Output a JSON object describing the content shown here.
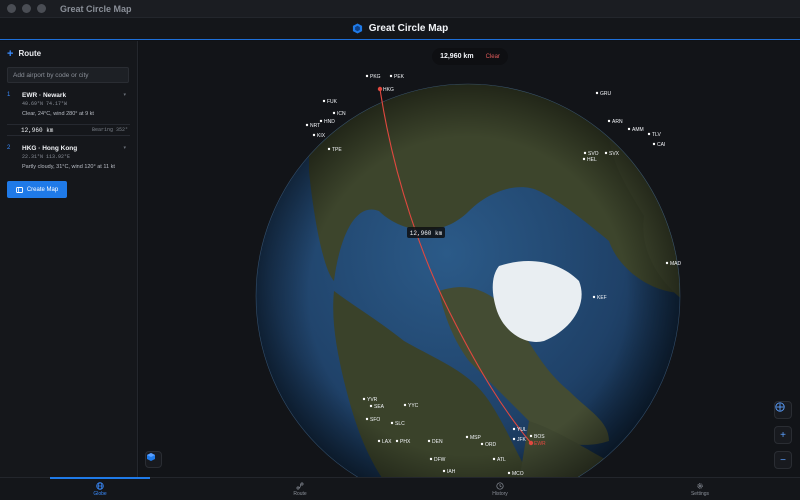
{
  "window": {
    "title": "Great Circle Map"
  },
  "header": {
    "app_name": "Great Circle Map"
  },
  "sidebar": {
    "section_title": "Route",
    "search_placeholder": "Add airport by code or city",
    "stops": [
      {
        "index": "1",
        "name": "EWR · Newark",
        "coords": "40.69°N 74.17°W",
        "weather": "Clear, 24°C, wind 280° at 9 kt"
      },
      {
        "index": "2",
        "name": "HKG · Hong Kong",
        "coords": "22.31°N 113.92°E",
        "weather": "Partly cloudy, 31°C, wind 120° at 11 kt"
      }
    ],
    "leg": {
      "distance": "12,960 km",
      "bearing": "Bearing 352°"
    },
    "create_button": "Create Map"
  },
  "map": {
    "distance_pill": "12,960 km",
    "clear_label": "Clear",
    "route_label": "12,960 km",
    "airports": [
      "PKG",
      "PEK",
      "ICN",
      "NRT",
      "KIX",
      "HND",
      "TPE",
      "HKG",
      "FUK",
      "GRU",
      "ARN",
      "HEL",
      "SVO",
      "SVX",
      "AMM",
      "TLV",
      "CAI",
      "KEF",
      "MAD",
      "YVR",
      "SEA",
      "YYC",
      "SFO",
      "SLC",
      "LAX",
      "PHX",
      "DEN",
      "MSP",
      "ORD",
      "YUL",
      "BOS",
      "JFK",
      "EWR",
      "ATL",
      "DFW",
      "IAH",
      "MCO"
    ],
    "colors": {
      "ocean": "#20446b",
      "land": "#3d452c",
      "ice": "#e9eef2",
      "route": "#e0483f",
      "accent": "#1f7ae8"
    }
  },
  "tabs": [
    {
      "label": "Globe",
      "icon": "globe-icon",
      "active": true
    },
    {
      "label": "Route",
      "icon": "route-icon",
      "active": false
    },
    {
      "label": "History",
      "icon": "history-icon",
      "active": false
    },
    {
      "label": "Settings",
      "icon": "gear-icon",
      "active": false
    }
  ]
}
